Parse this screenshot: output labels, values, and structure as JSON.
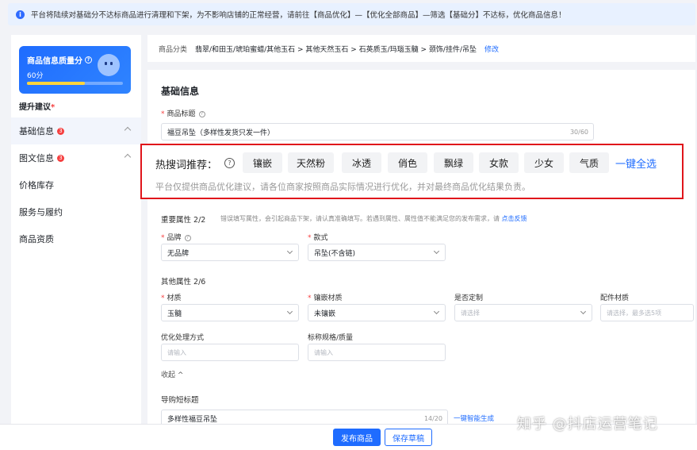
{
  "notice": {
    "text": "平台将陆续对基础分不达标商品进行清理和下架，为不影响店铺的正常经营，请前往【商品优化】—【优化全部商品】—筛选【基础分】不达标，优化商品信息！"
  },
  "sidebar": {
    "score_title": "商品信息质量分",
    "score_value": "60分",
    "score_progress": 0.6,
    "tips_label": "提升建议",
    "items": [
      {
        "label": "基础信息",
        "badge": "3"
      },
      {
        "label": "图文信息",
        "badge": "3"
      },
      {
        "label": "价格库存"
      },
      {
        "label": "服务与履约"
      },
      {
        "label": "商品资质"
      }
    ]
  },
  "category": {
    "label": "商品分类",
    "path": "翡翠/和田玉/琥珀蜜蜡/其他玉石 > 其他天然玉石 > 石英质玉/玛瑙玉髓 > 颈饰/挂件/吊坠",
    "edit": "修改"
  },
  "basic": {
    "title": "基础信息",
    "product_title_label": "商品标题",
    "product_title_value": "福豆吊坠（多样性发货只发一件）",
    "product_title_count": "30/60"
  },
  "hot_words": {
    "label": "热搜词推荐：",
    "chips": [
      "镶嵌",
      "天然粉",
      "冰透",
      "俏色",
      "飘绿",
      "女款",
      "少女",
      "气质"
    ],
    "select_all": "一键全选",
    "note": "平台仅提供商品优化建议，请各位商家按照商品实际情况进行优化，并对最终商品优化结果负责。"
  },
  "attrs": {
    "important_title": "重要属性 2/2",
    "important_note": "错误填写属性，会引起商品下架，请认真准确填写。若遇到属性、属性值不能满足您的发布需求，请",
    "feedback_link": "点击反馈",
    "brand_label": "品牌",
    "brand_value": "无品牌",
    "style_label": "款式",
    "style_value": "吊坠(不含链)",
    "other_title": "其他属性 2/6",
    "material_label": "材质",
    "material_value": "玉髓",
    "inlay_label": "镶嵌材质",
    "inlay_value": "未镶嵌",
    "custom_label": "是否定制",
    "custom_placeholder": "请选择",
    "accessory_label": "配件材质",
    "accessory_placeholder": "请选择，最多选5项",
    "process_label": "优化处理方式",
    "process_placeholder": "请输入",
    "spec_label": "标称规格/质量",
    "spec_placeholder": "请输入",
    "collapse": "收起",
    "short_title_label": "导购短标题",
    "short_title_value": "多样性福豆吊坠",
    "short_title_count": "14/20",
    "smart_generate": "一键智能生成"
  },
  "footer": {
    "publish": "发布商品",
    "save_draft": "保存草稿"
  },
  "watermark": "知乎 @抖店运营笔记"
}
